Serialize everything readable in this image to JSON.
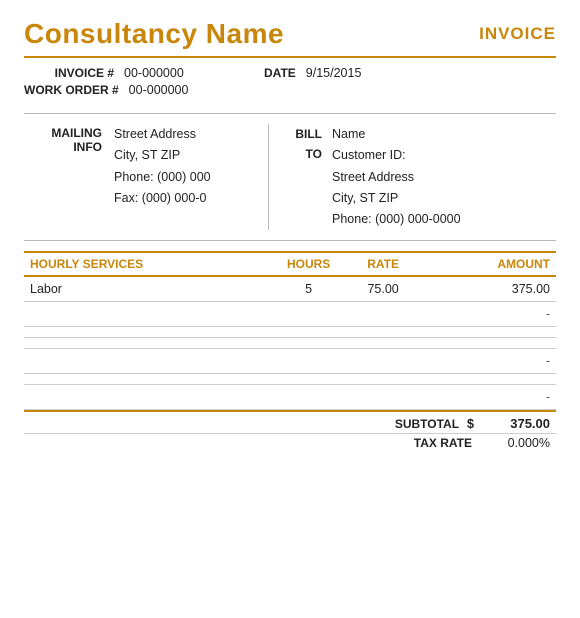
{
  "header": {
    "company_name": "Consultancy Name",
    "invoice_label": "INVOICE"
  },
  "invoice_info": {
    "invoice_label": "INVOICE #",
    "invoice_number": "00-000000",
    "date_label": "DATE",
    "date_value": "9/15/2015",
    "workorder_label": "WORK ORDER #",
    "workorder_number": "00-000000"
  },
  "mailing": {
    "section_label": "MAILING\nINFO",
    "street": "Street Address",
    "city_state_zip": "City, ST  ZIP",
    "phone": "Phone: (000) 000",
    "fax": "Fax: (000) 000-0"
  },
  "bill_to": {
    "label": "BILL\nTO",
    "name": "Name",
    "customer_id": "Customer ID:",
    "street": "Street Address",
    "city_state_zip": "City, ST  ZIP",
    "phone": "Phone: (000) 000-0000"
  },
  "services_table": {
    "headers": {
      "service": "HOURLY SERVICES",
      "hours": "HOURS",
      "rate": "RATE",
      "amount": "AMOUNT"
    },
    "rows": [
      {
        "service": "Labor",
        "hours": "5",
        "rate": "75.00",
        "amount": "375.00"
      },
      {
        "service": "",
        "hours": "",
        "rate": "",
        "amount": "-"
      },
      {
        "service": "",
        "hours": "",
        "rate": "",
        "amount": ""
      },
      {
        "service": "",
        "hours": "",
        "rate": "",
        "amount": ""
      },
      {
        "service": "",
        "hours": "",
        "rate": "",
        "amount": "-"
      },
      {
        "service": "",
        "hours": "",
        "rate": "",
        "amount": ""
      },
      {
        "service": "",
        "hours": "",
        "rate": "",
        "amount": "-"
      }
    ],
    "subtotal_label": "SUBTOTAL",
    "subtotal_dollar": "$",
    "subtotal_value": "375.00",
    "taxrate_label": "TAX RATE",
    "taxrate_value": "0.000%"
  }
}
